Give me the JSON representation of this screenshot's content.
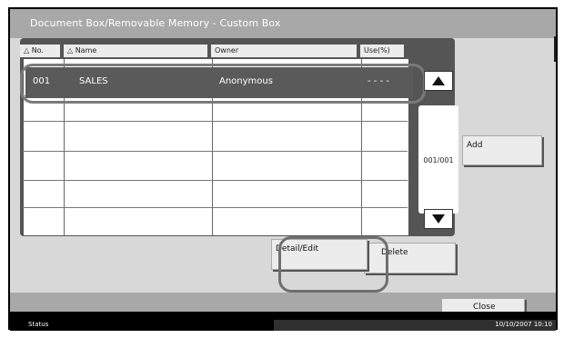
{
  "window": {
    "title": "Document Box/Removable Memory - Custom Box"
  },
  "table": {
    "headers": {
      "no": "△ No.",
      "name": "△ Name",
      "owner": "Owner",
      "use": "Use(%)"
    },
    "selected_row": {
      "no": "001",
      "name": "SALES",
      "owner": "Anonymous",
      "use": "- - - -"
    }
  },
  "pager": {
    "page": "001/001"
  },
  "buttons": {
    "add": "Add",
    "detail_edit": "Detail/Edit",
    "delete": "Delete",
    "close": "Close"
  },
  "status": {
    "label": "Status",
    "datetime": "10/10/2007   10:10"
  },
  "icons": {
    "up": "triangle-up-icon",
    "down": "triangle-down-icon"
  }
}
